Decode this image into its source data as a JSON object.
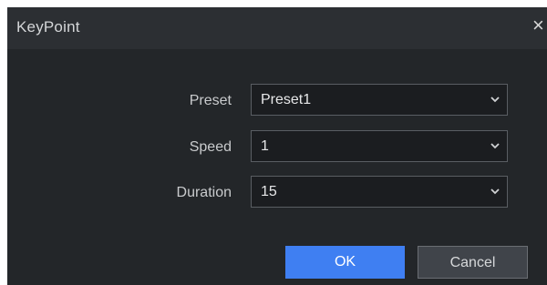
{
  "dialog": {
    "title": "KeyPoint",
    "close_glyph": "×"
  },
  "fields": [
    {
      "label": "Preset",
      "value": "Preset1"
    },
    {
      "label": "Speed",
      "value": "1"
    },
    {
      "label": "Duration",
      "value": "15"
    }
  ],
  "buttons": {
    "ok_label": "OK",
    "cancel_label": "Cancel"
  },
  "colors": {
    "accent": "#3f7ff2",
    "panel": "#232629"
  }
}
